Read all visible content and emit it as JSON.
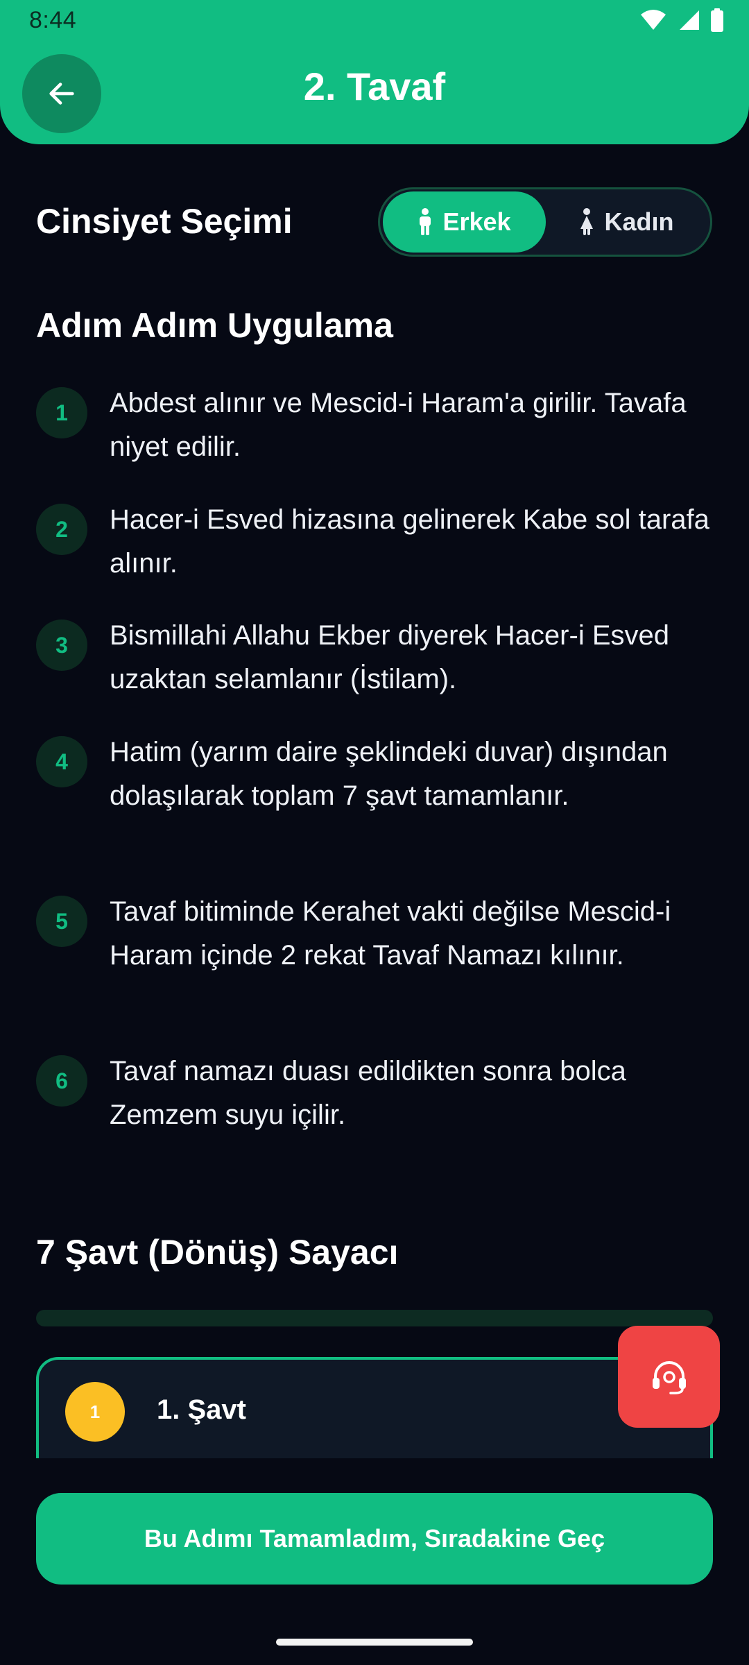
{
  "status_bar": {
    "time": "8:44",
    "icons": [
      "wifi-icon",
      "signal-icon",
      "battery-icon"
    ]
  },
  "header": {
    "title": "2. Tavaf",
    "back_icon": "arrow-left-icon"
  },
  "gender": {
    "title": "Cinsiyet Seçimi",
    "options": [
      {
        "label": "Erkek",
        "icon": "male-icon",
        "selected": true
      },
      {
        "label": "Kadın",
        "icon": "female-icon",
        "selected": false
      }
    ]
  },
  "steps": {
    "title": "Adım Adım Uygulama",
    "items": [
      {
        "num": "1",
        "text": "Abdest alınır ve Mescid-i Haram'a girilir. Tavafa niyet edilir."
      },
      {
        "num": "2",
        "text": "Hacer-i Esved hizasına gelinerek Kabe sol tarafa alınır."
      },
      {
        "num": "3",
        "text": "Bismillahi Allahu Ekber diyerek Hacer-i Esved uzaktan selamlanır (İstilam)."
      },
      {
        "num": "4",
        "text": "Hatim (yarım daire şeklindeki duvar) dışından dolaşılarak toplam 7 şavt tamamlanır."
      },
      {
        "num": "5",
        "text": "Tavaf bitiminde Kerahet vakti değilse Mescid-i Haram içinde 2 rekat Tavaf Namazı kılınır."
      },
      {
        "num": "6",
        "text": "Tavaf namazı duası edildikten sonra bolca Zemzem suyu içilir."
      }
    ]
  },
  "counter": {
    "title": "7 Şavt (Dönüş) Sayacı",
    "progress_fraction": 0,
    "current": {
      "num": "1",
      "label": "1. Şavt"
    }
  },
  "fab": {
    "icon": "headset-support-icon"
  },
  "primary_button": {
    "label": "Bu Adımı Tamamladım, Sıradakine Geç"
  },
  "colors": {
    "accent": "#11bd82",
    "background": "#060914",
    "fab": "#ef4444",
    "badge": "#fbbf24"
  }
}
